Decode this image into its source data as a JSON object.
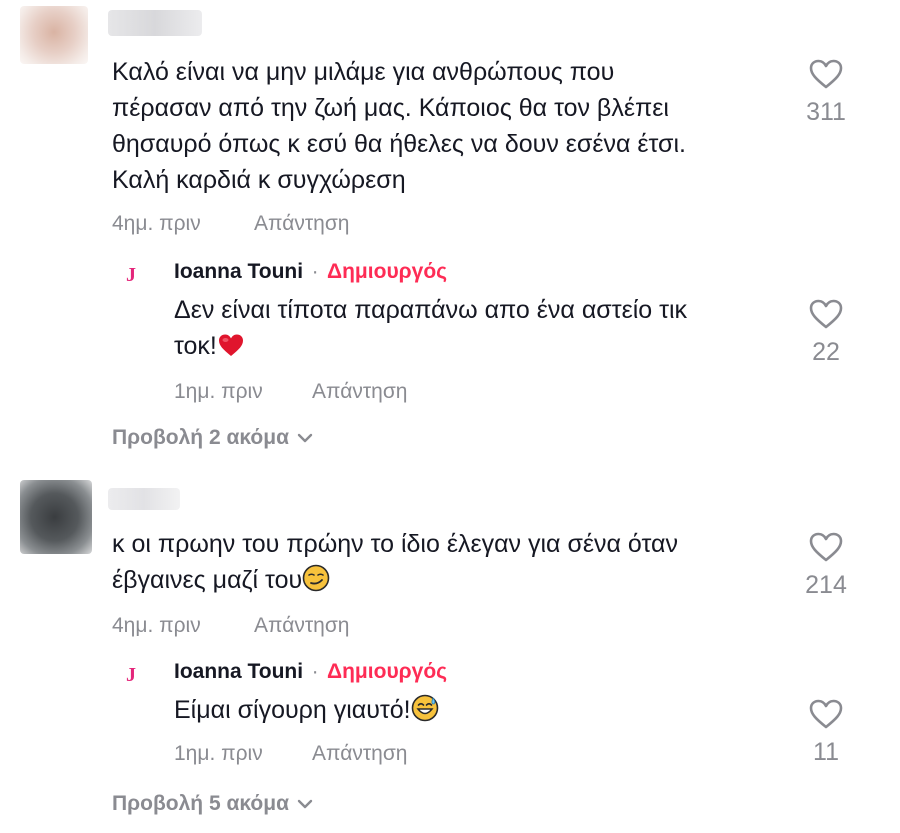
{
  "comments": [
    {
      "text": "Καλό είναι να μην μιλάμε για ανθρώπους που\nπέρασαν από την ζωή μας. Κάποιος θα τον βλέπει\nθησαυρό όπως κ εσύ θα ήθελες να δουν εσένα έτσι.\nΚαλή καρδιά κ συγχώρεση",
      "time": "4ημ. πριν",
      "reply_label": "Απάντηση",
      "likes": "311",
      "reply": {
        "initial": "J",
        "author": "Ioanna Touni",
        "separator": "·",
        "badge": "Δημιουργός",
        "text": "Δεν είναι τίποτα παραπάνω απο ένα αστείο τικ\nτοκ!",
        "emoji": "red-heart",
        "time": "1ημ. πριν",
        "reply_label": "Απάντηση",
        "likes": "22"
      },
      "view_more": "Προβολή 2 ακόμα"
    },
    {
      "text": "κ οι πρωην του πρώην το ίδιο έλεγαν για σένα όταν\nέβγαινες μαζί του",
      "emoji": "smirking-face",
      "time": "4ημ. πριν",
      "reply_label": "Απάντηση",
      "likes": "214",
      "reply": {
        "initial": "J",
        "author": "Ioanna Touni",
        "separator": "·",
        "badge": "Δημιουργός",
        "text": "Είμαι σίγουρη γιαυτό!",
        "emoji": "grinning-sweat-face",
        "time": "1ημ. πριν",
        "reply_label": "Απάντηση",
        "likes": "11"
      },
      "view_more": "Προβολή 5 ακόμα"
    }
  ],
  "colors": {
    "text": "#161823",
    "muted": "#8a8b91",
    "creator_badge": "#fe2c55",
    "creator_initial": "#e4267a"
  }
}
